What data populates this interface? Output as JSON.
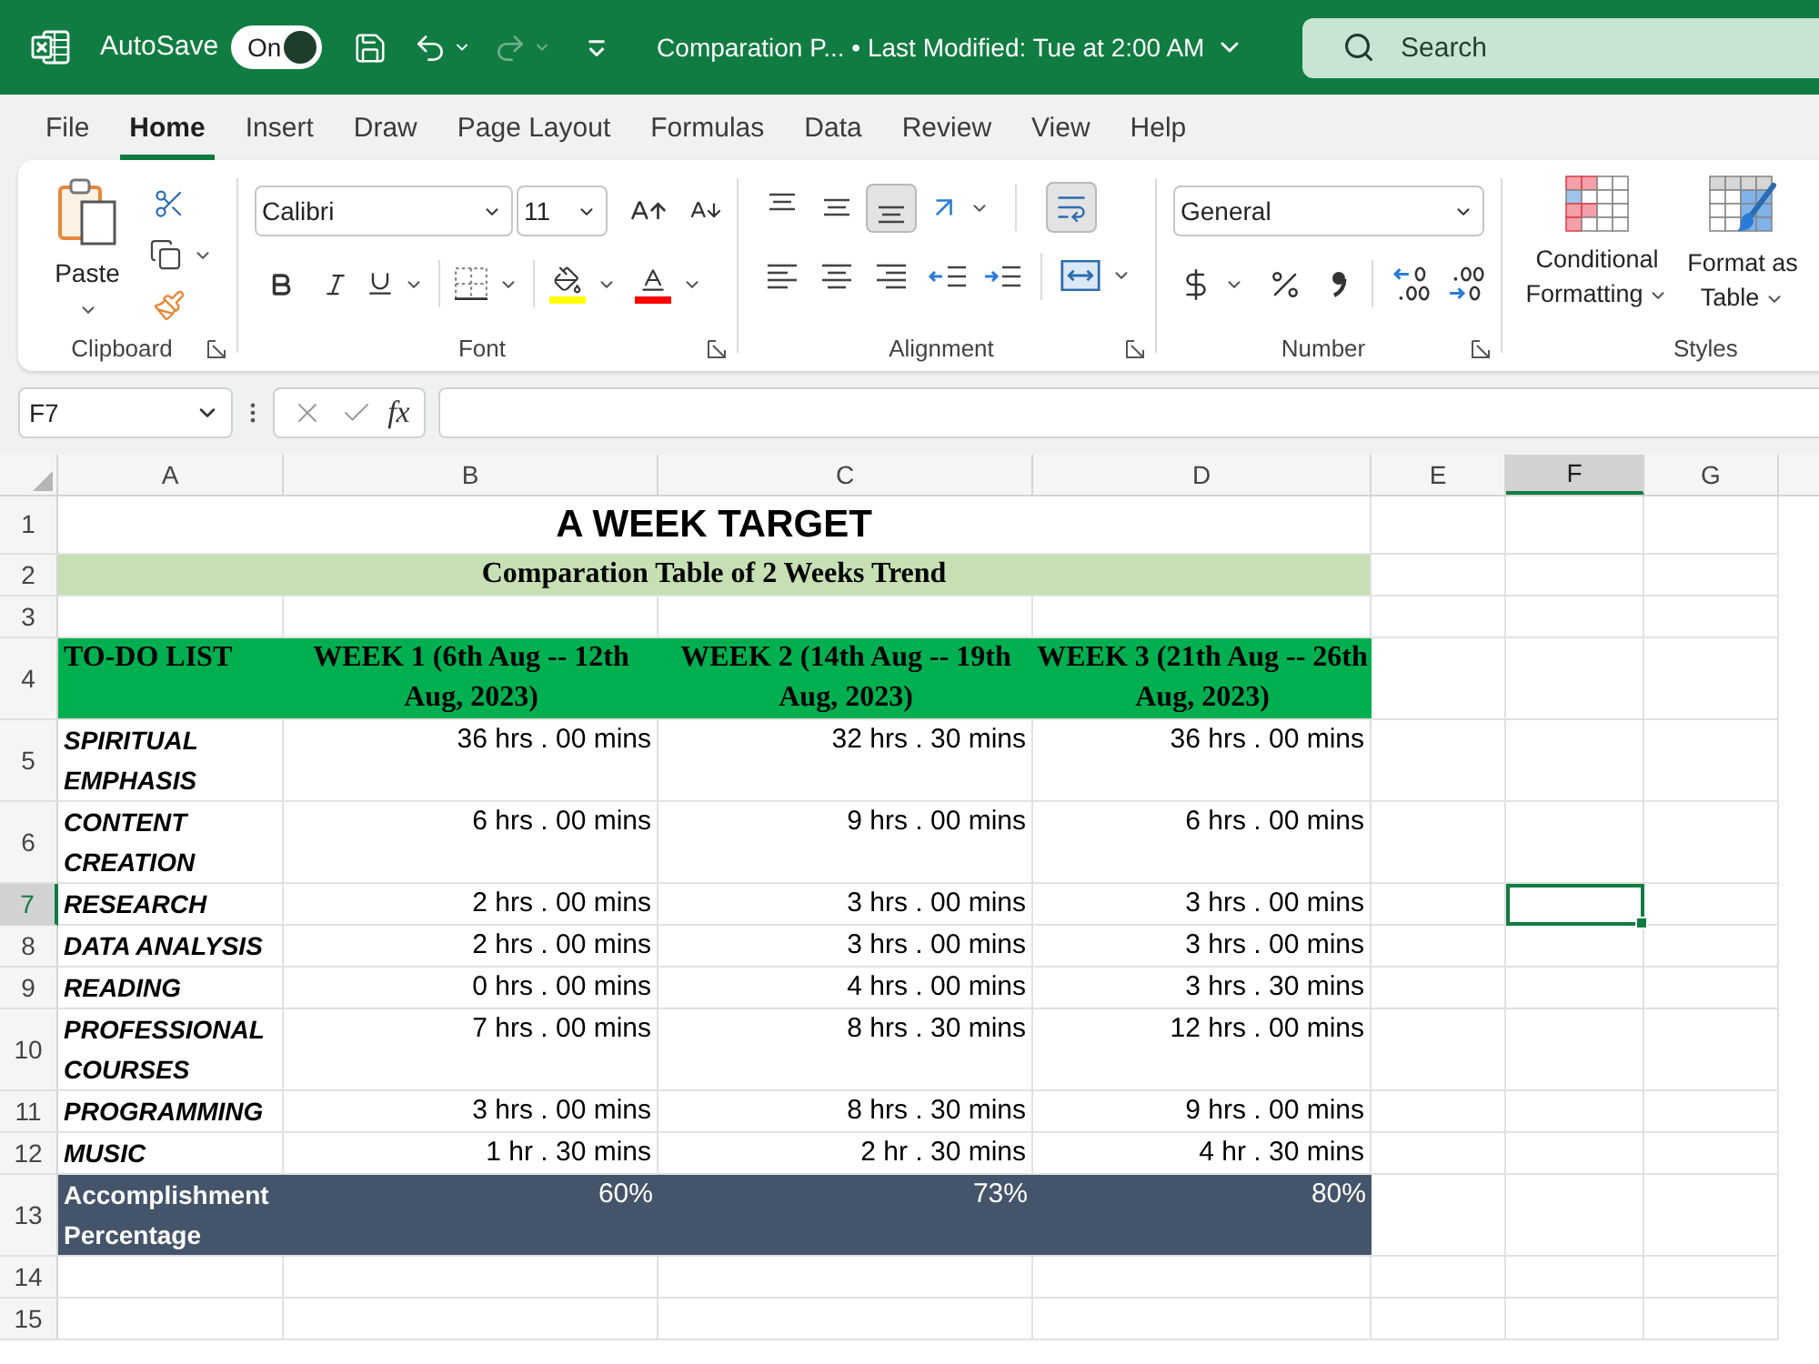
{
  "title_bar": {
    "autosave_label": "AutoSave",
    "autosave": {
      "on": true,
      "text": "On"
    },
    "undo": {
      "disabled": false
    },
    "redo": {
      "disabled": true
    },
    "document_title": "Comparation P... • Last Modified: Tue at 2:00 AM",
    "search": {
      "placeholder": "Search"
    }
  },
  "ribbon_tabs": [
    {
      "label": "File",
      "selected": false
    },
    {
      "label": "Home",
      "selected": true
    },
    {
      "label": "Insert",
      "selected": false
    },
    {
      "label": "Draw",
      "selected": false
    },
    {
      "label": "Page Layout",
      "selected": false
    },
    {
      "label": "Formulas",
      "selected": false
    },
    {
      "label": "Data",
      "selected": false
    },
    {
      "label": "Review",
      "selected": false
    },
    {
      "label": "View",
      "selected": false
    },
    {
      "label": "Help",
      "selected": false
    }
  ],
  "ribbon": {
    "clipboard": {
      "title": "Clipboard",
      "paste_label": "Paste"
    },
    "font": {
      "title": "Font",
      "font_name": "Calibri",
      "font_size": "11"
    },
    "alignment": {
      "title": "Alignment",
      "vertical_buttons": [
        {
          "kind": "top",
          "selected": false
        },
        {
          "kind": "middle",
          "selected": false
        },
        {
          "kind": "bottom",
          "selected": true
        }
      ],
      "wrap_text": {
        "selected": true
      },
      "horizontal_buttons": [
        {
          "kind": "left",
          "selected": false
        },
        {
          "kind": "center",
          "selected": false
        },
        {
          "kind": "right",
          "selected": false
        }
      ]
    },
    "number": {
      "title": "Number",
      "format": "General"
    },
    "styles": {
      "title": "Styles",
      "buttons": [
        {
          "kind": "conditional",
          "label": "Conditional Formatting"
        },
        {
          "kind": "table",
          "label": "Format as Table"
        }
      ]
    }
  },
  "formula_bar": {
    "name_box": "F7",
    "function_label": "fx"
  },
  "sheet": {
    "columns": [
      {
        "label": "A",
        "selected": false
      },
      {
        "label": "B",
        "selected": false
      },
      {
        "label": "C",
        "selected": false
      },
      {
        "label": "D",
        "selected": false
      },
      {
        "label": "E",
        "selected": false
      },
      {
        "label": "F",
        "selected": true
      },
      {
        "label": "G",
        "selected": false
      }
    ],
    "rows": [
      {
        "number": "1",
        "selected": false,
        "kind": "title",
        "cells": [
          "A WEEK TARGET"
        ]
      },
      {
        "number": "2",
        "selected": false,
        "kind": "subtitle",
        "cells": [
          "Comparation Table of 2 Weeks Trend"
        ]
      },
      {
        "number": "3",
        "selected": false,
        "kind": "empty"
      },
      {
        "number": "4",
        "selected": false,
        "kind": "header",
        "cells": [
          "TO-DO LIST",
          "WEEK 1 (6th Aug -- 12th Aug, 2023)",
          "WEEK 2 (14th Aug -- 19th Aug, 2023)",
          "WEEK 3 (21th Aug -- 26th Aug, 2023)"
        ]
      },
      {
        "number": "5",
        "selected": false,
        "kind": "task",
        "cells": [
          "SPIRITUAL EMPHASIS",
          "36 hrs . 00 mins",
          "32 hrs . 30 mins",
          "36 hrs . 00 mins"
        ]
      },
      {
        "number": "6",
        "selected": false,
        "kind": "task",
        "cells": [
          "CONTENT CREATION",
          "6 hrs . 00 mins",
          "9 hrs . 00 mins",
          "6 hrs . 00 mins"
        ]
      },
      {
        "number": "7",
        "selected": true,
        "kind": "task",
        "cells": [
          "RESEARCH",
          "2 hrs . 00 mins",
          "3 hrs . 00 mins",
          "3 hrs . 00 mins"
        ]
      },
      {
        "number": "8",
        "selected": false,
        "kind": "task",
        "cells": [
          "DATA ANALYSIS",
          "2 hrs . 00 mins",
          "3 hrs . 00 mins",
          "3 hrs . 00 mins"
        ]
      },
      {
        "number": "9",
        "selected": false,
        "kind": "task",
        "cells": [
          "READING",
          "0 hrs . 00 mins",
          "4 hrs . 00 mins",
          "3 hrs . 30 mins"
        ]
      },
      {
        "number": "10",
        "selected": false,
        "kind": "task",
        "cells": [
          "PROFESSIONAL COURSES",
          "7 hrs . 00 mins",
          "8 hrs . 30 mins",
          "12 hrs . 00 mins"
        ]
      },
      {
        "number": "11",
        "selected": false,
        "kind": "task",
        "cells": [
          "PROGRAMMING",
          "3 hrs . 00 mins",
          "8 hrs . 30 mins",
          "9 hrs . 00 mins"
        ]
      },
      {
        "number": "12",
        "selected": false,
        "kind": "task",
        "cells": [
          "MUSIC",
          "1 hr . 30 mins",
          "2 hr . 30 mins",
          "4 hr . 30 mins"
        ]
      },
      {
        "number": "13",
        "selected": false,
        "kind": "summary",
        "cells": [
          "Accomplishment Percentage",
          "60%",
          "73%",
          "80%"
        ]
      },
      {
        "number": "14",
        "selected": false,
        "kind": "empty"
      },
      {
        "number": "15",
        "selected": false,
        "kind": "empty"
      }
    ]
  }
}
